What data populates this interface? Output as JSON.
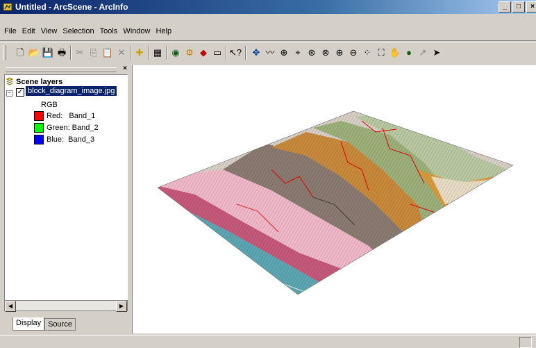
{
  "window": {
    "title": "Untitled - ArcScene - ArcInfo"
  },
  "menu": [
    "File",
    "Edit",
    "View",
    "Selection",
    "Tools",
    "Window",
    "Help"
  ],
  "toc": {
    "root_label": "Scene layers",
    "layer": {
      "name": "block_diagram_image.jpg",
      "checked": true,
      "legend_title": "RGB",
      "bands": [
        {
          "label": "Red:   Band_1",
          "color": "#ff0000"
        },
        {
          "label": "Green: Band_2",
          "color": "#00ff00"
        },
        {
          "label": "Blue:  Band_3",
          "color": "#0000ff"
        }
      ]
    }
  },
  "tabs": {
    "display": "Display",
    "source": "Source",
    "active": "Display"
  }
}
